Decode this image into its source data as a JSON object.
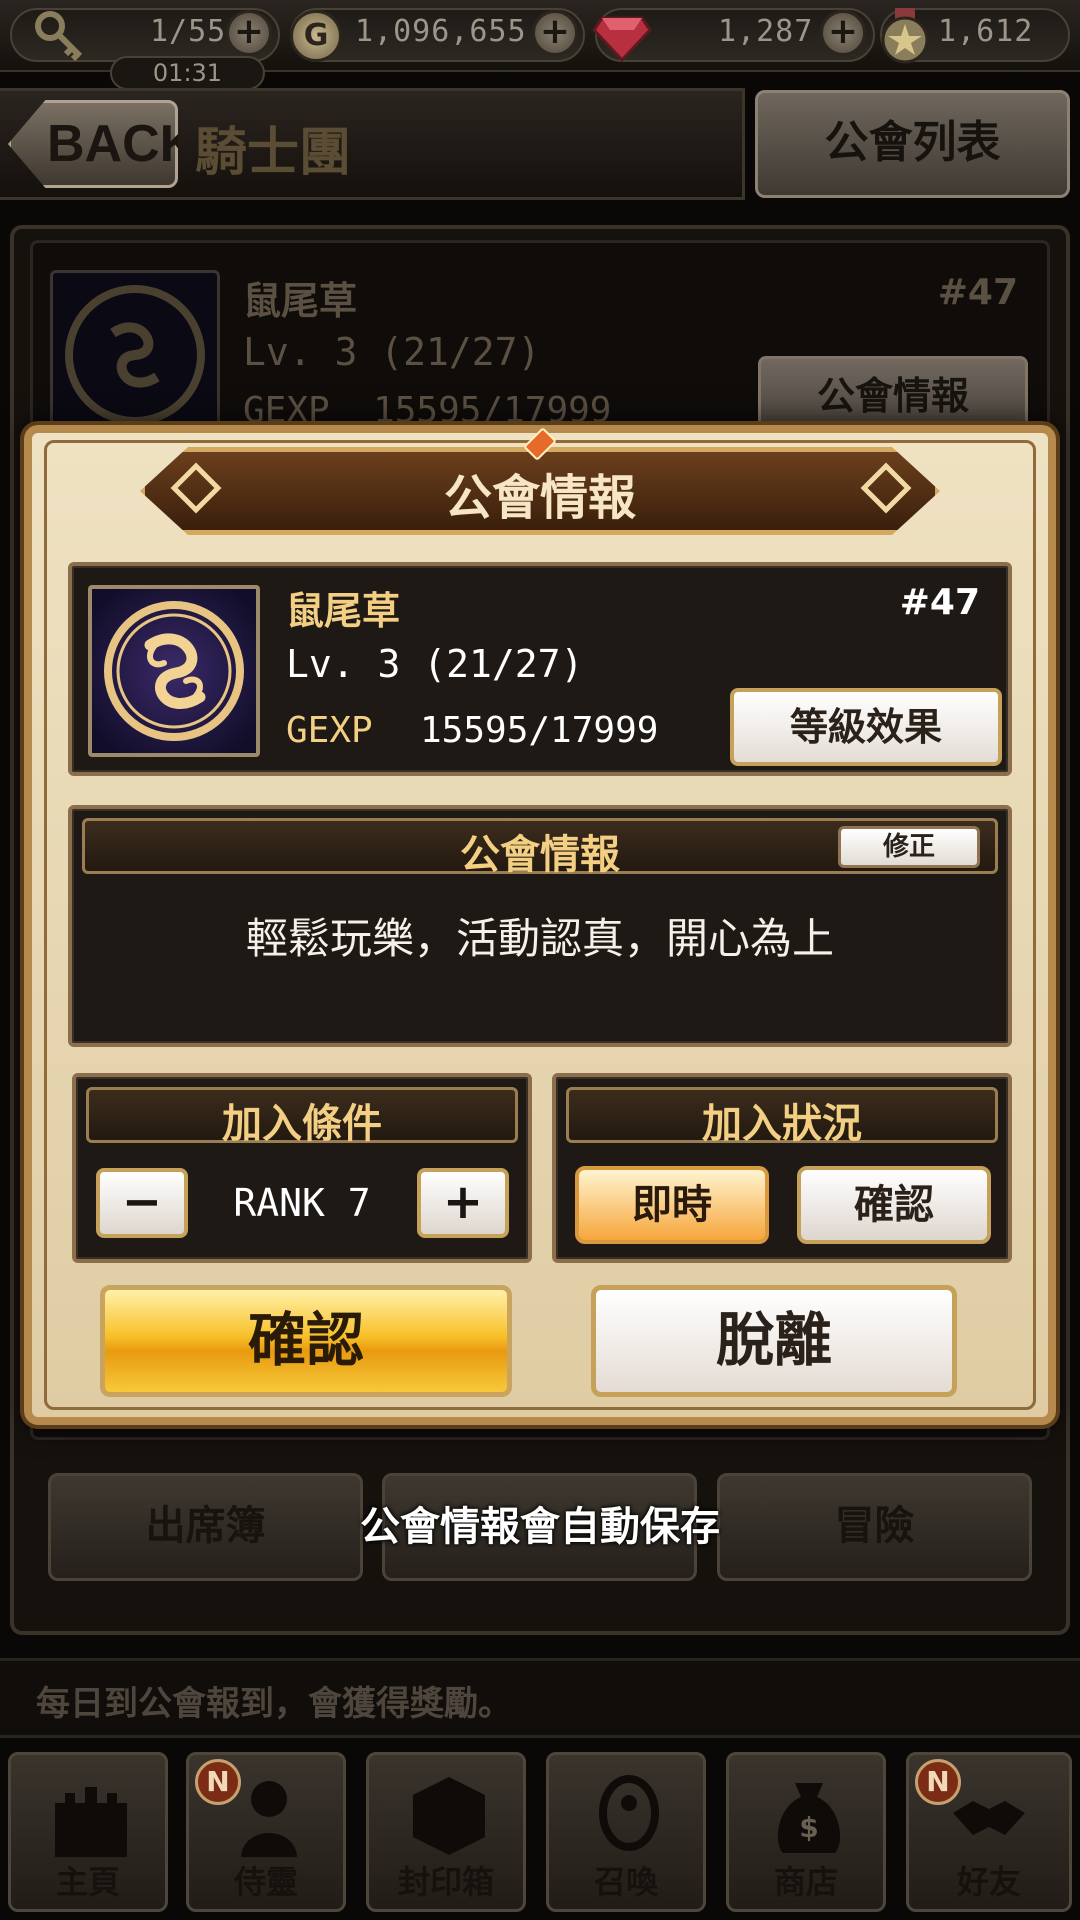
{
  "status_bar": {
    "stamina": "1/55",
    "timer": "01:31",
    "gold": "1,096,655",
    "gems": "1,287",
    "stars": "1,612",
    "colors": {
      "gem": "#d63a4a",
      "coin": "#b8a57a"
    }
  },
  "header": {
    "back_label": "BACK",
    "title": "騎士團",
    "guild_list_label": "公會列表"
  },
  "background": {
    "guild_name": "鼠尾草",
    "rank": "#47",
    "level": "Lv. 3  (21/27)",
    "gexp_label": "GEXP",
    "gexp_value": "15595/17999",
    "guild_info_button": "公會情報",
    "buttons": [
      "出席簿",
      "公會情報會自動保存",
      "冒險"
    ],
    "hint": "每日到公會報到，會獲得獎勵。"
  },
  "modal": {
    "title": "公會情報",
    "guild_name": "鼠尾草",
    "rank": "#47",
    "level": "Lv. 3  (21/27)",
    "gexp_label": "GEXP",
    "gexp_value": "15595/17999",
    "level_effect_label": "等級效果",
    "notice_header": "公會情報",
    "edit_label": "修正",
    "notice_text": "輕鬆玩樂，活動認真，開心為上",
    "join_condition_header": "加入條件",
    "rank_value": "RANK  7",
    "join_status_header": "加入狀況",
    "instant_label": "即時",
    "approve_label": "確認",
    "confirm_label": "確認",
    "leave_label": "脫離"
  },
  "toast": "公會情報會自動保存",
  "nav": {
    "items": [
      {
        "label": "主頁",
        "icon": "castle-icon",
        "badge": ""
      },
      {
        "label": "侍靈",
        "icon": "spirit-icon",
        "badge": "N"
      },
      {
        "label": "封印箱",
        "icon": "seal-box-icon",
        "badge": ""
      },
      {
        "label": "召喚",
        "icon": "summon-icon",
        "badge": ""
      },
      {
        "label": "商店",
        "icon": "shop-bag-icon",
        "badge": ""
      },
      {
        "label": "好友",
        "icon": "handshake-icon",
        "badge": "N"
      }
    ]
  }
}
